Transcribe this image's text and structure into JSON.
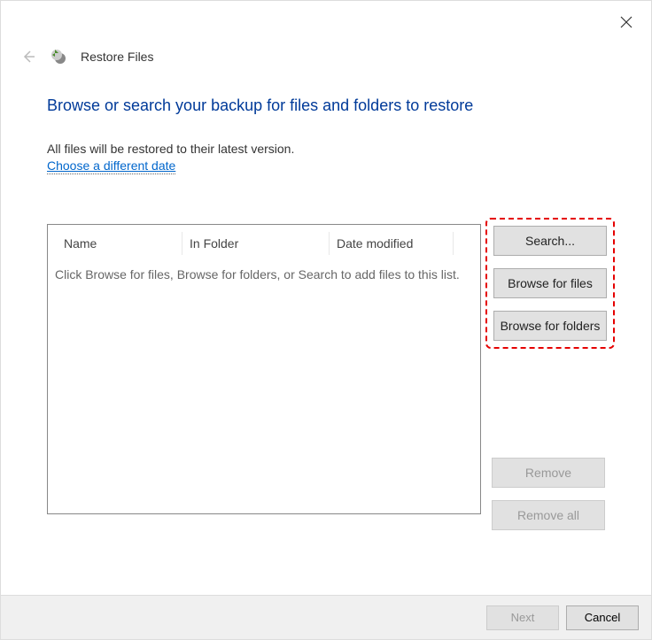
{
  "window": {
    "title": "Restore Files"
  },
  "page": {
    "heading": "Browse or search your backup for files and folders to restore",
    "info": "All files will be restored to their latest version.",
    "link": "Choose a different date"
  },
  "list": {
    "columns": {
      "name": "Name",
      "folder": "In Folder",
      "date": "Date modified"
    },
    "empty_message": "Click Browse for files, Browse for folders, or Search to add files to this list."
  },
  "buttons": {
    "search": "Search...",
    "browse_files": "Browse for files",
    "browse_folders": "Browse for folders",
    "remove": "Remove",
    "remove_all": "Remove all",
    "next": "Next",
    "cancel": "Cancel"
  }
}
